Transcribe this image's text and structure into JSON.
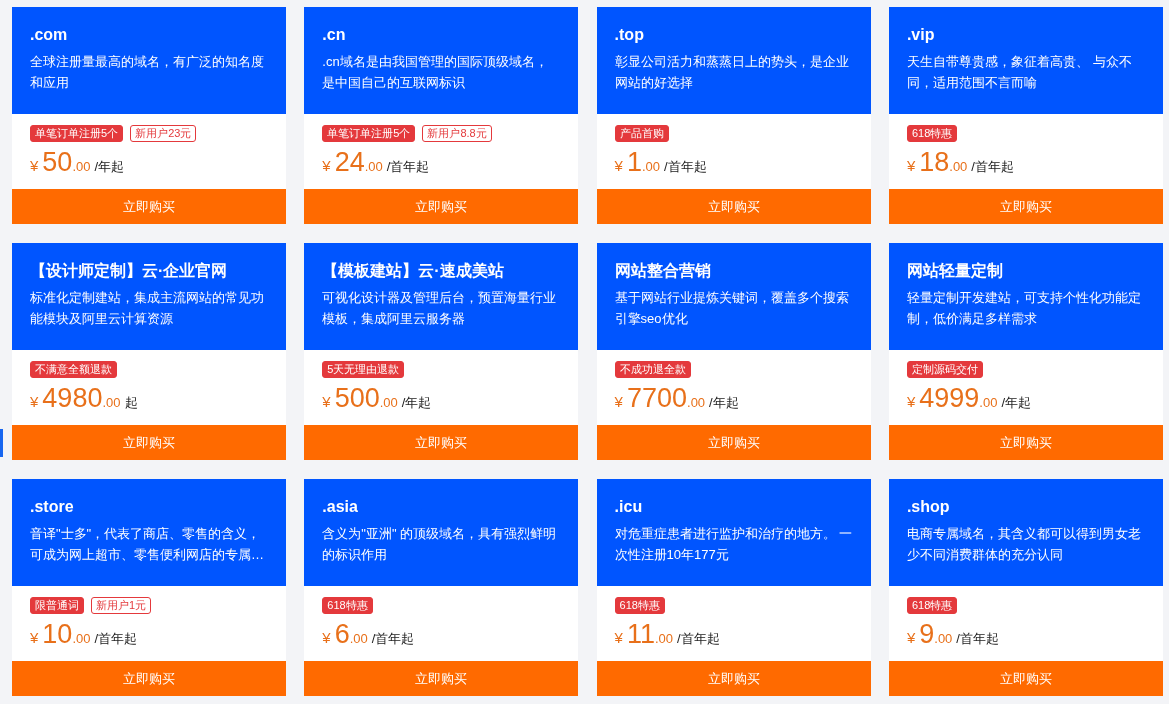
{
  "products": [
    {
      "title": ".com",
      "description": "全球注册量最高的域名，有广泛的知名度和应用",
      "tags": [
        {
          "text": "单笔订单注册5个",
          "kind": "filled"
        },
        {
          "text": "新用户23元",
          "kind": "outline"
        }
      ],
      "price": {
        "currency": "¥",
        "amount": "50",
        "decimals": ".00",
        "unit": "/年起"
      },
      "button": "立即购买"
    },
    {
      "title": ".cn",
      "description": ".cn域名是由我国管理的国际顶级域名，是中国自己的互联网标识",
      "tags": [
        {
          "text": "单笔订单注册5个",
          "kind": "filled"
        },
        {
          "text": "新用户8.8元",
          "kind": "outline"
        }
      ],
      "price": {
        "currency": "¥",
        "amount": "24",
        "decimals": ".00",
        "unit": "/首年起"
      },
      "button": "立即购买"
    },
    {
      "title": ".top",
      "description": "彰显公司活力和蒸蒸日上的势头，是企业网站的好选择",
      "tags": [
        {
          "text": "产品首购",
          "kind": "filled"
        }
      ],
      "price": {
        "currency": "¥",
        "amount": "1",
        "decimals": ".00",
        "unit": "/首年起"
      },
      "button": "立即购买"
    },
    {
      "title": ".vip",
      "description": "天生自带尊贵感，象征着高贵、 与众不同，适用范围不言而喻",
      "tags": [
        {
          "text": "618特惠",
          "kind": "filled"
        }
      ],
      "price": {
        "currency": "¥",
        "amount": "18",
        "decimals": ".00",
        "unit": "/首年起"
      },
      "button": "立即购买"
    },
    {
      "title": "【设计师定制】云·企业官网",
      "description": "标准化定制建站，集成主流网站的常见功能模块及阿里云计算资源",
      "tags": [
        {
          "text": "不满意全额退款",
          "kind": "filled"
        }
      ],
      "price": {
        "currency": "¥",
        "amount": "4980",
        "decimals": ".00",
        "unit": "起"
      },
      "button": "立即购买"
    },
    {
      "title": "【模板建站】云·速成美站",
      "description": "可视化设计器及管理后台，预置海量行业模板，集成阿里云服务器",
      "tags": [
        {
          "text": "5天无理由退款",
          "kind": "filled"
        }
      ],
      "price": {
        "currency": "¥",
        "amount": "500",
        "decimals": ".00",
        "unit": "/年起"
      },
      "button": "立即购买"
    },
    {
      "title": "网站整合营销",
      "description": "基于网站行业提炼关键词，覆盖多个搜索引擎seo优化",
      "tags": [
        {
          "text": "不成功退全款",
          "kind": "filled"
        }
      ],
      "price": {
        "currency": "¥",
        "amount": "7700",
        "decimals": ".00",
        "unit": "/年起"
      },
      "button": "立即购买"
    },
    {
      "title": "网站轻量定制",
      "description": "轻量定制开发建站，可支持个性化功能定制，低价满足多样需求",
      "tags": [
        {
          "text": "定制源码交付",
          "kind": "filled"
        }
      ],
      "price": {
        "currency": "¥",
        "amount": "4999",
        "decimals": ".00",
        "unit": "/年起"
      },
      "button": "立即购买"
    },
    {
      "title": ".store",
      "description": "音译\"士多\"，代表了商店、零售的含义，可成为网上超市、零售便利网店的专属…",
      "tags": [
        {
          "text": "限普通词",
          "kind": "filled"
        },
        {
          "text": "新用户1元",
          "kind": "outline"
        }
      ],
      "price": {
        "currency": "¥",
        "amount": "10",
        "decimals": ".00",
        "unit": "/首年起"
      },
      "button": "立即购买"
    },
    {
      "title": ".asia",
      "description": "含义为\"亚洲\" 的顶级域名，具有强烈鲜明的标识作用",
      "tags": [
        {
          "text": "618特惠",
          "kind": "filled"
        }
      ],
      "price": {
        "currency": "¥",
        "amount": "6",
        "decimals": ".00",
        "unit": "/首年起"
      },
      "button": "立即购买"
    },
    {
      "title": ".icu",
      "description": "对危重症患者进行监护和治疗的地方。 一次性注册10年177元",
      "tags": [
        {
          "text": "618特惠",
          "kind": "filled"
        }
      ],
      "price": {
        "currency": "¥",
        "amount": "11",
        "decimals": ".00",
        "unit": "/首年起"
      },
      "button": "立即购买"
    },
    {
      "title": ".shop",
      "description": "电商专属域名，其含义都可以得到男女老少不同消费群体的充分认同",
      "tags": [
        {
          "text": "618特惠",
          "kind": "filled"
        }
      ],
      "price": {
        "currency": "¥",
        "amount": "9",
        "decimals": ".00",
        "unit": "/首年起"
      },
      "button": "立即购买"
    }
  ]
}
